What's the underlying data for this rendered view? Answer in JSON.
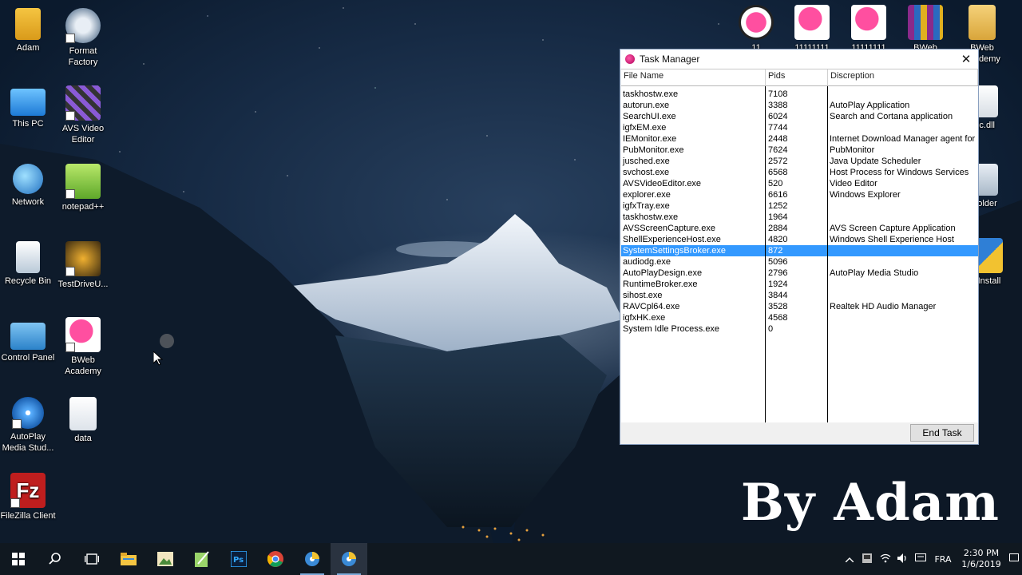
{
  "desktop_left": [
    {
      "label": "Adam",
      "icon": "user-folder-icon"
    },
    {
      "label": "Format Factory",
      "icon": "format-factory-icon"
    },
    {
      "label": "This PC",
      "icon": "computer-icon"
    },
    {
      "label": "AVS Video Editor",
      "icon": "film-icon"
    },
    {
      "label": "Network",
      "icon": "network-globe-icon"
    },
    {
      "label": "notepad++",
      "icon": "notepad-icon"
    },
    {
      "label": "Recycle Bin",
      "icon": "recycle-bin-icon"
    },
    {
      "label": "TestDriveU...",
      "icon": "game-icon"
    },
    {
      "label": "Control Panel",
      "icon": "control-panel-icon"
    },
    {
      "label": "BWeb Academy",
      "icon": "bweb-icon"
    },
    {
      "label": "AutoPlay Media Stud...",
      "icon": "disc-icon"
    },
    {
      "label": "data",
      "icon": "file-gear-icon"
    },
    {
      "label": "FileZilla Client",
      "icon": "filezilla-icon"
    }
  ],
  "desktop_right": [
    {
      "label": "11",
      "icon": "bweb-icon"
    },
    {
      "label": "11111111",
      "icon": "bweb-icon"
    },
    {
      "label": "11111111",
      "icon": "bweb-icon"
    },
    {
      "label": "BWeb",
      "icon": "winrar-icon"
    },
    {
      "label": "BWeb Academy",
      "icon": "bweb-folder-icon"
    },
    {
      "label": "lc.dll",
      "icon": "dll-icon"
    },
    {
      "label": "folder",
      "icon": "folder-icon"
    },
    {
      "label": "Install",
      "icon": "install-icon"
    }
  ],
  "window": {
    "title": "Task Manager",
    "close": "✕",
    "headers": {
      "name": "File Name",
      "pid": "Pids",
      "desc": "Discreption"
    },
    "rows": [
      {
        "name": "taskhostw.exe",
        "pid": "7108",
        "desc": ""
      },
      {
        "name": "autorun.exe",
        "pid": "3388",
        "desc": "AutoPlay Application"
      },
      {
        "name": "SearchUI.exe",
        "pid": "6024",
        "desc": "Search and Cortana application"
      },
      {
        "name": "igfxEM.exe",
        "pid": "7744",
        "desc": ""
      },
      {
        "name": "IEMonitor.exe",
        "pid": "2448",
        "desc": "Internet Download Manager agent for"
      },
      {
        "name": "PubMonitor.exe",
        "pid": "7624",
        "desc": "PubMonitor"
      },
      {
        "name": "jusched.exe",
        "pid": "2572",
        "desc": "Java Update Scheduler"
      },
      {
        "name": "svchost.exe",
        "pid": "6568",
        "desc": "Host Process for Windows Services"
      },
      {
        "name": "AVSVideoEditor.exe",
        "pid": "520",
        "desc": "Video Editor"
      },
      {
        "name": "explorer.exe",
        "pid": "6616",
        "desc": "Windows Explorer"
      },
      {
        "name": "igfxTray.exe",
        "pid": "1252",
        "desc": ""
      },
      {
        "name": "taskhostw.exe",
        "pid": "1964",
        "desc": ""
      },
      {
        "name": "AVSScreenCapture.exe",
        "pid": "2884",
        "desc": "AVS Screen Capture Application"
      },
      {
        "name": "ShellExperienceHost.exe",
        "pid": "4820",
        "desc": "Windows Shell Experience Host"
      },
      {
        "name": "SystemSettingsBroker.exe",
        "pid": "872",
        "desc": "",
        "selected": true
      },
      {
        "name": "audiodg.exe",
        "pid": "5096",
        "desc": ""
      },
      {
        "name": "AutoPlayDesign.exe",
        "pid": "2796",
        "desc": "AutoPlay Media Studio"
      },
      {
        "name": "RuntimeBroker.exe",
        "pid": "1924",
        "desc": ""
      },
      {
        "name": "sihost.exe",
        "pid": "3844",
        "desc": ""
      },
      {
        "name": "RAVCpl64.exe",
        "pid": "3528",
        "desc": "Realtek HD Audio Manager"
      },
      {
        "name": "igfxHK.exe",
        "pid": "4568",
        "desc": ""
      },
      {
        "name": "System Idle Process.exe",
        "pid": "0",
        "desc": ""
      }
    ],
    "end_task": "End Task"
  },
  "watermark": "By Adam",
  "taskbar": {
    "items": [
      "start-icon",
      "search-icon",
      "task-view-icon",
      "file-explorer-icon",
      "photos-icon",
      "notepad-icon",
      "photoshop-icon",
      "chrome-icon",
      "autoplay-icon",
      "autoplay-active-icon"
    ],
    "language": "FRA",
    "time": "2:30 PM",
    "date": "1/6/2019"
  },
  "colors": {
    "selection": "#3399ff",
    "taskbar": "#101820"
  }
}
